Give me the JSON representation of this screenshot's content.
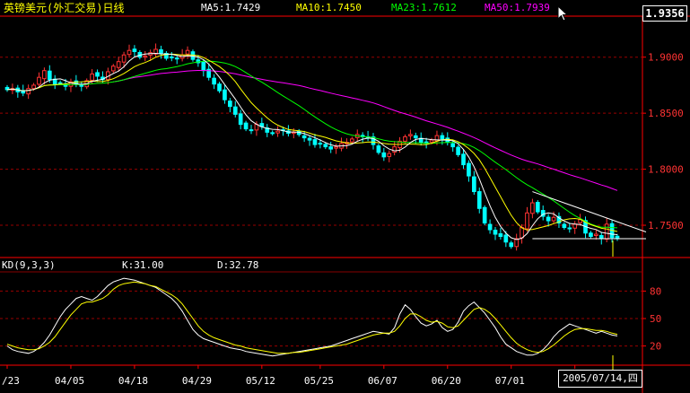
{
  "header": {
    "title": "英镑美元(外汇交易)日线",
    "ma5": "MA5:1.7429",
    "ma10": "MA10:1.7450",
    "ma23": "MA23:1.7612",
    "ma50": "MA50:1.7939",
    "last_price": "1.9356"
  },
  "kd": {
    "name": "KD(9,3,3)",
    "k_label": "K:31.00",
    "d_label": "D:32.78"
  },
  "cursor_date": "2005/07/14,四",
  "colors": {
    "background": "#000000",
    "up_candle": "#ff3333",
    "down_candle": "#00ffff",
    "ma5": "#ffffff",
    "ma10": "#ffff00",
    "ma23": "#00ff00",
    "ma50": "#ff00ff",
    "grid": "#990000",
    "axis_text": "#ff3333"
  },
  "chart_data": [
    {
      "type": "candlestick",
      "title": "英镑美元(外汇交易)日线",
      "x_tick_labels": [
        "/23",
        "04/05",
        "04/18",
        "04/29",
        "05/12",
        "05/25",
        "06/07",
        "06/20",
        "07/01",
        "07/"
      ],
      "y_tick_labels": [
        "1.9000",
        "1.8500",
        "1.8000",
        "1.7500"
      ],
      "ylim": [
        1.722,
        1.935
      ],
      "grid": true,
      "legend": [
        "MA5:1.7429",
        "MA10:1.7450",
        "MA23:1.7612",
        "MA50:1.7939"
      ],
      "series": [
        {
          "name": "MA5",
          "latest": 1.7429
        },
        {
          "name": "MA10",
          "latest": 1.745
        },
        {
          "name": "MA23",
          "latest": 1.7612
        },
        {
          "name": "MA50",
          "latest": 1.7939
        }
      ],
      "close": [
        1.871,
        1.872,
        1.869,
        1.868,
        1.872,
        1.875,
        1.882,
        1.888,
        1.88,
        1.876,
        1.877,
        1.874,
        1.878,
        1.876,
        1.874,
        1.879,
        1.885,
        1.883,
        1.88,
        1.887,
        1.892,
        1.896,
        1.902,
        1.906,
        1.905,
        1.9,
        1.901,
        1.904,
        1.907,
        1.903,
        1.899,
        1.9,
        1.899,
        1.902,
        1.906,
        1.898,
        1.895,
        1.888,
        1.882,
        1.876,
        1.87,
        1.862,
        1.856,
        1.849,
        1.84,
        1.836,
        1.835,
        1.84,
        1.838,
        1.833,
        1.832,
        1.834,
        1.835,
        1.832,
        1.833,
        1.831,
        1.828,
        1.826,
        1.822,
        1.823,
        1.82,
        1.818,
        1.82,
        1.823,
        1.824,
        1.827,
        1.831,
        1.829,
        1.828,
        1.822,
        1.815,
        1.811,
        1.814,
        1.82,
        1.825,
        1.829,
        1.831,
        1.828,
        1.824,
        1.823,
        1.826,
        1.83,
        1.827,
        1.824,
        1.82,
        1.813,
        1.804,
        1.794,
        1.78,
        1.765,
        1.752,
        1.746,
        1.742,
        1.74,
        1.735,
        1.731,
        1.738,
        1.748,
        1.761,
        1.77,
        1.762,
        1.758,
        1.754,
        1.757,
        1.752,
        1.748,
        1.747,
        1.751,
        1.755,
        1.743,
        1.74,
        1.742,
        1.738,
        1.751,
        1.739,
        1.738
      ]
    },
    {
      "type": "line",
      "title": "KD(9,3,3)",
      "y_tick_labels": [
        "80",
        "50",
        "20"
      ],
      "ylim": [
        0,
        100
      ],
      "series": [
        {
          "name": "K",
          "latest": 31.0,
          "values": [
            20,
            16,
            14,
            13,
            12,
            14,
            18,
            24,
            32,
            42,
            52,
            60,
            66,
            72,
            74,
            72,
            70,
            74,
            80,
            86,
            90,
            92,
            94,
            93,
            92,
            90,
            88,
            86,
            84,
            80,
            76,
            72,
            66,
            58,
            48,
            38,
            32,
            28,
            26,
            24,
            22,
            20,
            18,
            17,
            16,
            14,
            13,
            12,
            11,
            10,
            9,
            10,
            11,
            12,
            13,
            14,
            15,
            16,
            17,
            18,
            19,
            20,
            22,
            24,
            26,
            28,
            30,
            32,
            34,
            36,
            35,
            34,
            33,
            40,
            55,
            65,
            60,
            52,
            45,
            42,
            44,
            48,
            40,
            36,
            38,
            46,
            58,
            64,
            68,
            62,
            56,
            48,
            40,
            30,
            22,
            18,
            14,
            12,
            10,
            10,
            12,
            16,
            22,
            30,
            36,
            40,
            44,
            42,
            40,
            38,
            36,
            34,
            36,
            34,
            32,
            31
          ]
        },
        {
          "name": "D",
          "latest": 32.78,
          "values": [
            22,
            20,
            18,
            17,
            16,
            16,
            17,
            20,
            24,
            30,
            38,
            46,
            54,
            60,
            66,
            68,
            68,
            70,
            72,
            76,
            82,
            86,
            88,
            89,
            90,
            89,
            88,
            86,
            85,
            82,
            79,
            76,
            72,
            66,
            58,
            50,
            42,
            36,
            32,
            29,
            27,
            25,
            23,
            21,
            20,
            18,
            17,
            16,
            15,
            14,
            13,
            12,
            12,
            12,
            13,
            13,
            14,
            15,
            16,
            17,
            18,
            19,
            20,
            21,
            22,
            24,
            26,
            28,
            30,
            32,
            33,
            34,
            34,
            36,
            42,
            50,
            55,
            55,
            52,
            48,
            46,
            47,
            45,
            41,
            40,
            42,
            48,
            54,
            60,
            62,
            60,
            56,
            50,
            43,
            36,
            29,
            23,
            19,
            16,
            14,
            13,
            14,
            17,
            21,
            26,
            31,
            35,
            38,
            39,
            39,
            38,
            37,
            37,
            36,
            34,
            32.78
          ]
        }
      ]
    }
  ]
}
